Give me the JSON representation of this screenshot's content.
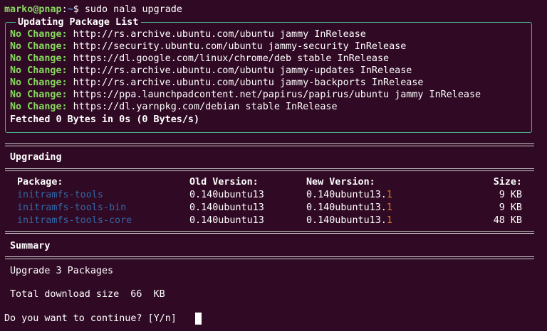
{
  "prompt": {
    "user_host": "marko@pnap",
    "separator": ":",
    "path": "~",
    "symbol": "$",
    "command": " sudo nala upgrade"
  },
  "update_box": {
    "title": "Updating Package List",
    "lines": [
      {
        "status": "No Change:",
        "text": " http://rs.archive.ubuntu.com/ubuntu jammy InRelease"
      },
      {
        "status": "No Change:",
        "text": " http://security.ubuntu.com/ubuntu jammy-security InRelease"
      },
      {
        "status": "No Change:",
        "text": " https://dl.google.com/linux/chrome/deb stable InRelease"
      },
      {
        "status": "No Change:",
        "text": " http://rs.archive.ubuntu.com/ubuntu jammy-updates InRelease"
      },
      {
        "status": "No Change:",
        "text": " http://rs.archive.ubuntu.com/ubuntu jammy-backports InRelease"
      },
      {
        "status": "No Change:",
        "text": " https://ppa.launchpadcontent.net/papirus/papirus/ubuntu jammy InRelease"
      },
      {
        "status": "No Change:",
        "text": " https://dl.yarnpkg.com/debian stable InRelease"
      }
    ],
    "fetched": "Fetched 0 Bytes in 0s (0 Bytes/s)"
  },
  "upgrading": {
    "heading": "Upgrading",
    "columns": {
      "package": "Package:",
      "old": "Old Version:",
      "new": "New Version:",
      "size": "Size:"
    },
    "rows": [
      {
        "package": "initramfs-tools",
        "old": "0.140ubuntu13",
        "new_base": "0.140ubuntu13.",
        "new_suffix": "1",
        "size": "9 KB"
      },
      {
        "package": "initramfs-tools-bin",
        "old": "0.140ubuntu13",
        "new_base": "0.140ubuntu13.",
        "new_suffix": "1",
        "size": "9 KB"
      },
      {
        "package": "initramfs-tools-core",
        "old": "0.140ubuntu13",
        "new_base": "0.140ubuntu13.",
        "new_suffix": "1",
        "size": "48 KB"
      }
    ]
  },
  "summary": {
    "heading": "Summary",
    "upgrade_line": "Upgrade 3 Packages",
    "download_line": "Total download size  66  KB"
  },
  "confirm": {
    "question": "Do you want to continue? [Y/n] "
  },
  "colors": {
    "background": "#300a24",
    "status_green": "#87d75f",
    "package_blue": "#3465a4",
    "version_highlight": "#e07b2b",
    "box_border": "#4cb08a"
  }
}
